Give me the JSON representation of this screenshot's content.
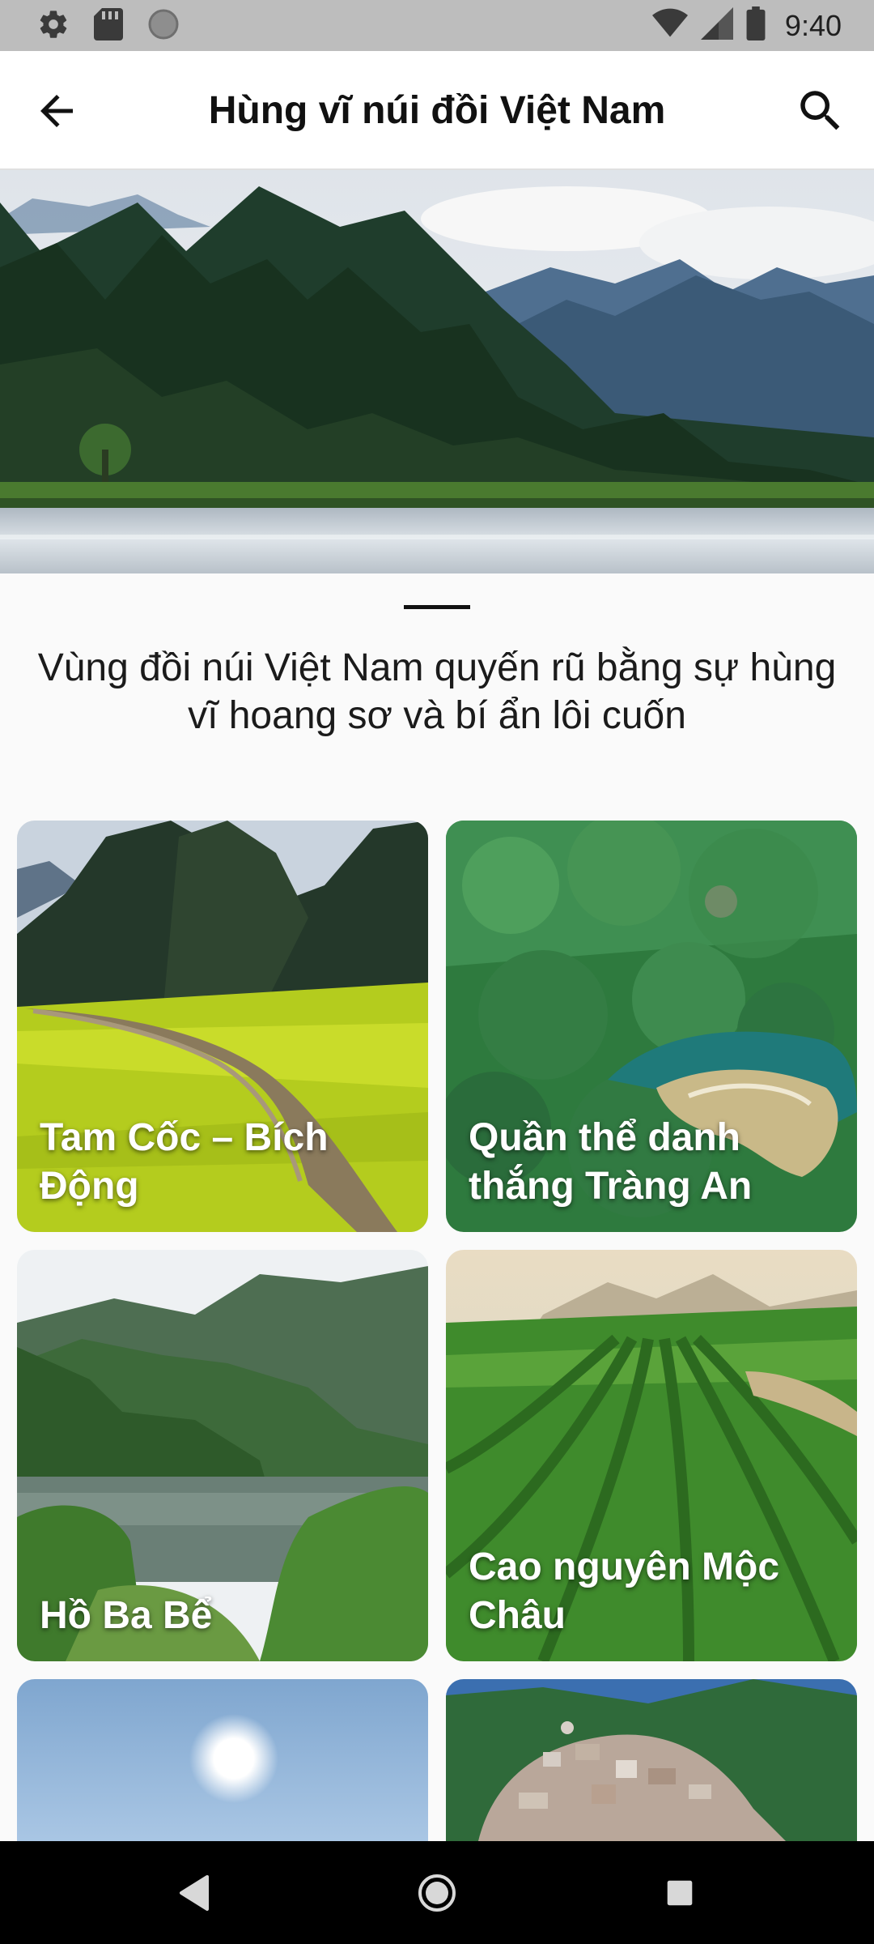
{
  "status_bar": {
    "time": "9:40",
    "icons": [
      "settings-icon",
      "sd-card-icon",
      "circle-icon",
      "wifi-icon",
      "signal-icon",
      "battery-icon"
    ]
  },
  "app_bar": {
    "title": "Hùng vĩ núi đồi Việt Nam",
    "back_icon": "arrow-left-icon",
    "search_icon": "search-icon"
  },
  "intro_text": "Vùng đồi núi Việt Nam quyến rũ bằng sự hùng vĩ hoang sơ và bí ẩn lôi cuốn",
  "cards": [
    {
      "title": "Tam Cốc – Bích Động"
    },
    {
      "title": "Quần thể danh thắng Tràng An"
    },
    {
      "title": "Hồ Ba Bể"
    },
    {
      "title": "Cao nguyên Mộc Châu"
    },
    {
      "title": ""
    },
    {
      "title": ""
    }
  ],
  "nav_bar": {
    "icons": [
      "nav-back-icon",
      "nav-home-icon",
      "nav-recent-icon"
    ]
  },
  "colors": {
    "status_bar_bg": "#bdbdbd",
    "app_bar_bg": "#ffffff",
    "page_bg": "#fafafa",
    "nav_bar_bg": "#000000"
  }
}
